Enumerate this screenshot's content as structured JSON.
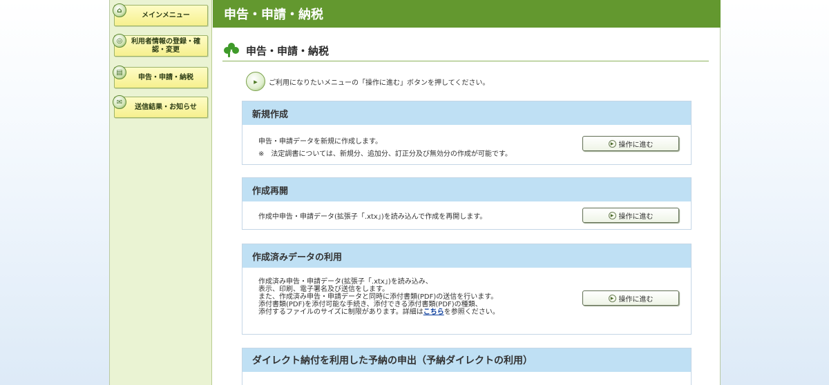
{
  "sidebar": {
    "items": [
      {
        "label": "メインメニュー"
      },
      {
        "label": "利用者情報の登録・確認・変更"
      },
      {
        "label": "申告・申請・納税"
      },
      {
        "label": "送信結果・お知らせ"
      }
    ]
  },
  "header": {
    "title": "申告・申請・納税"
  },
  "page": {
    "title": "申告・申請・納税"
  },
  "notice": {
    "text": "ご利用になりたいメニューの「操作に進む」ボタンを押してください。"
  },
  "panels": [
    {
      "title": "新規作成",
      "lines": [
        "申告・申請データを新規に作成します。",
        "※　法定調書については、新規分、追加分、訂正分及び無効分の作成が可能です。"
      ],
      "button": "操作に進む"
    },
    {
      "title": "作成再開",
      "lines": [
        "作成中申告・申請データ(拡張子「.xtx」)を読み込んで作成を再開します。"
      ],
      "button": "操作に進む"
    },
    {
      "title": "作成済みデータの利用",
      "lines": [
        "作成済み申告・申請データ(拡張子「.xtx」)を読み込み、",
        "表示、印刷、電子署名及び送信をします。",
        "また、作成済み申告・申請データと同時に添付書類(PDF)の送信を行います。",
        "添付書類(PDF)を添付可能な手続き、添付できる添付書類(PDF)の種類、",
        "添付するファイルのサイズに制限があります。詳細は"
      ],
      "link": "こちら",
      "link_suffix": "を参照ください。",
      "button": "操作に進む"
    },
    {
      "title": "ダイレクト納付を利用した予納の申出（予納ダイレクトの利用）"
    }
  ]
}
